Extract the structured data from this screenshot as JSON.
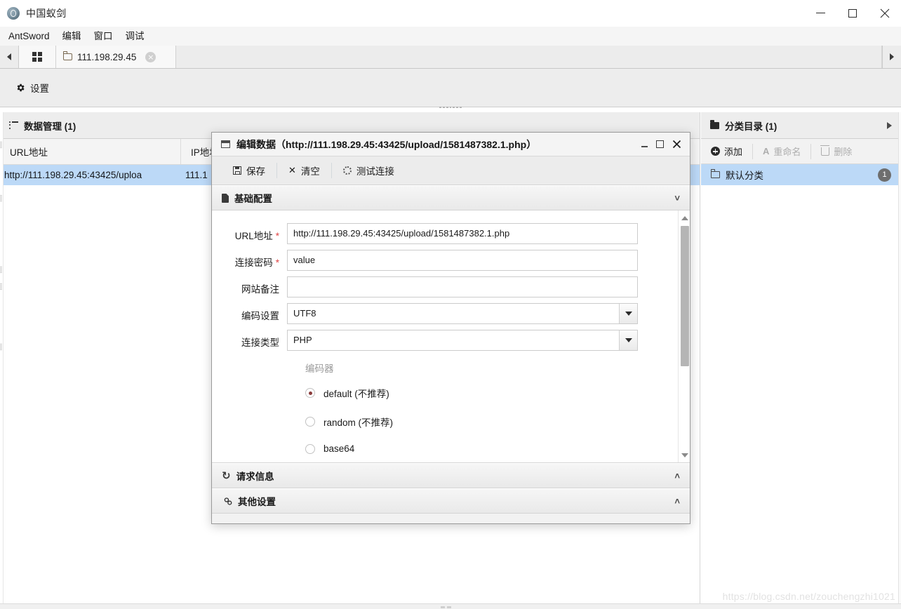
{
  "window": {
    "title": "中国蚁剑",
    "app_icon": "antsword-logo-icon",
    "controls": {
      "minimize": "minimize-icon",
      "maximize": "maximize-icon",
      "close": "close-icon"
    }
  },
  "menubar": {
    "items": [
      {
        "label": "AntSword"
      },
      {
        "label": "编辑"
      },
      {
        "label": "窗口"
      },
      {
        "label": "调试"
      }
    ]
  },
  "tabstrip": {
    "scroll_left": "chevron-left-icon",
    "scroll_right": "chevron-right-icon",
    "home_tab": "grid-icon",
    "tabs": [
      {
        "label": "111.198.29.45",
        "icon": "folder-icon",
        "close": "×"
      }
    ]
  },
  "toolbar": {
    "settings_label": "设置",
    "settings_icon": "gear-icon"
  },
  "left_panel": {
    "header": "数据管理 (1)",
    "header_icon": "list-icon",
    "columns": [
      "URL地址",
      "IP地址"
    ],
    "rows": [
      {
        "url": "http://111.198.29.45:43425/uploa",
        "ip": "111.1"
      }
    ]
  },
  "right_panel": {
    "header": "分类目录 (1)",
    "header_icon": "folder-filled-icon",
    "expand_icon": "chevron-right-icon",
    "toolbar": [
      {
        "label": "添加",
        "icon": "plus-circle-icon",
        "enabled": true
      },
      {
        "label": "重命名",
        "icon": "rename-icon",
        "enabled": false
      },
      {
        "label": "删除",
        "icon": "trash-icon",
        "enabled": false
      }
    ],
    "items": [
      {
        "label": "默认分类",
        "icon": "folder-outline-icon",
        "count": "1"
      }
    ]
  },
  "dialog": {
    "title": "编辑数据（http://111.198.29.45:43425/upload/1581487382.1.php）",
    "title_icon": "window-icon",
    "controls": {
      "minimize": "minimize-icon",
      "maximize": "maximize-icon",
      "close": "close-icon"
    },
    "toolbar": [
      {
        "label": "保存",
        "icon": "save-icon"
      },
      {
        "label": "清空",
        "icon": "clear-x-icon"
      },
      {
        "label": "测试连接",
        "icon": "spinner-icon"
      }
    ],
    "sections": [
      {
        "key": "basic",
        "label": "基础配置",
        "icon": "document-icon",
        "chevron": "˅",
        "expanded": true
      },
      {
        "key": "request",
        "label": "请求信息",
        "icon": "refresh-icon",
        "chevron": "˄",
        "expanded": false
      },
      {
        "key": "other",
        "label": "其他设置",
        "icon": "gears-icon",
        "chevron": "˄",
        "expanded": false
      }
    ],
    "form": {
      "fields": [
        {
          "label": "URL地址",
          "required": true,
          "type": "text",
          "value": "http://111.198.29.45:43425/upload/1581487382.1.php",
          "placeholder": ""
        },
        {
          "label": "连接密码",
          "required": true,
          "type": "text",
          "value": "value",
          "placeholder": ""
        },
        {
          "label": "网站备注",
          "required": false,
          "type": "text",
          "value": "",
          "placeholder": ""
        },
        {
          "label": "编码设置",
          "required": false,
          "type": "select",
          "value": "UTF8",
          "placeholder": ""
        },
        {
          "label": "连接类型",
          "required": false,
          "type": "select",
          "value": "PHP",
          "placeholder": ""
        }
      ],
      "encoder": {
        "title": "编码器",
        "options": [
          {
            "label": "default (不推荐)",
            "selected": true
          },
          {
            "label": "random (不推荐)",
            "selected": false
          },
          {
            "label": "base64",
            "selected": false
          }
        ]
      }
    },
    "scrollbar": {
      "up": "scroll-up-arrow-icon",
      "down": "scroll-down-arrow-icon"
    }
  },
  "watermark": {
    "text": "https://blog.csdn.net/zouchengzhi1021"
  },
  "colors": {
    "selection": "#bcd9f7",
    "required": "#e04545",
    "radio_dot": "#8a3b3b",
    "chrome": "#ececec"
  }
}
